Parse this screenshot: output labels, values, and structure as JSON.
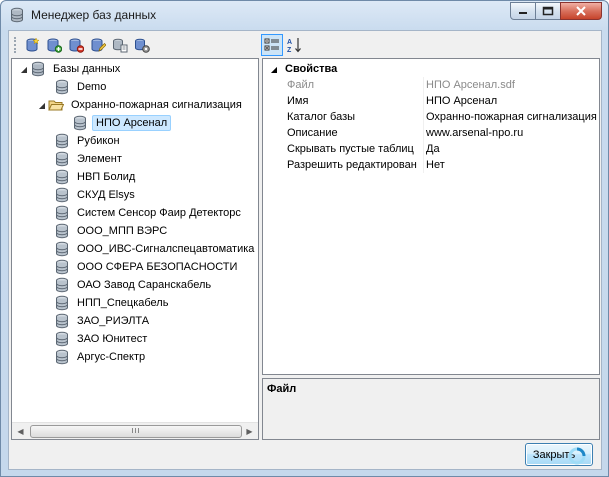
{
  "window": {
    "title": "Менеджер баз данных"
  },
  "toolbar": {
    "left_buttons": [
      "db-add-icon",
      "db-new-icon",
      "db-delete-icon",
      "db-edit-icon",
      "db-copy-icon",
      "db-settings-icon"
    ],
    "right_buttons": [
      "categorized-icon",
      "sort-alphabetical-icon"
    ]
  },
  "tree": {
    "root": "Базы данных",
    "items": [
      {
        "label": "Demo"
      },
      {
        "label": "Охранно-пожарная сигнализация",
        "expanded": true
      },
      {
        "label": "НПО Арсенал",
        "selected": true
      },
      {
        "label": "Рубикон"
      },
      {
        "label": "Элемент"
      },
      {
        "label": "НВП Болид"
      },
      {
        "label": "СКУД Elsys"
      },
      {
        "label": "Систем Сенсор Фаир Детекторс"
      },
      {
        "label": "ООО_МПП ВЭРС"
      },
      {
        "label": "ООО_ИВС-Сигналспецавтоматика"
      },
      {
        "label": "ООО СФЕРА БЕЗОПАСНОСТИ"
      },
      {
        "label": "ОАО Завод Саранскабель"
      },
      {
        "label": "НПП_Спецкабель"
      },
      {
        "label": "ЗАО_РИЭЛТА"
      },
      {
        "label": "ЗАО Юнитест"
      },
      {
        "label": "Аргус-Спектр"
      }
    ],
    "scroll_thumb": "III"
  },
  "properties": {
    "category": "Свойства",
    "rows": [
      {
        "name": "Файл",
        "value": "НПО Арсенал.sdf",
        "disabled": true
      },
      {
        "name": "Имя",
        "value": "НПО Арсенал"
      },
      {
        "name": "Каталог базы",
        "value": "Охранно-пожарная сигнализация"
      },
      {
        "name": "Описание",
        "value": "www.arsenal-npo.ru"
      },
      {
        "name": "Скрывать пустые таблиц",
        "value": "Да"
      },
      {
        "name": "Разрешить редактирован",
        "value": "Нет"
      }
    ]
  },
  "description": {
    "title": "Файл"
  },
  "buttons": {
    "close": "Закрыть"
  }
}
